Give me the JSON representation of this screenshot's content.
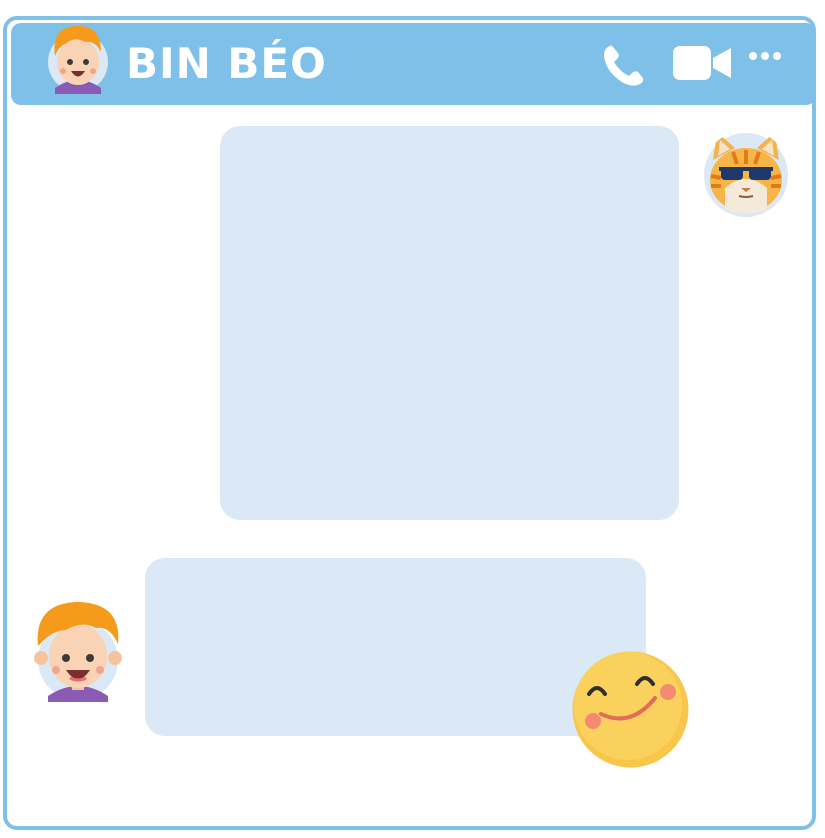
{
  "chat": {
    "contact_name": "BIN BÉO",
    "header_actions": [
      {
        "icon": "phone-icon"
      },
      {
        "icon": "video-camera-icon"
      },
      {
        "icon": "more-dots-icon"
      }
    ]
  },
  "messages": [
    {
      "sender": "cat",
      "text": ""
    },
    {
      "sender": "contact",
      "text": "",
      "reaction": "smiley-icon"
    }
  ],
  "colors": {
    "frame": "#7fc0e8",
    "bubble": "#dbe8f6",
    "header_text": "#ffffff"
  }
}
